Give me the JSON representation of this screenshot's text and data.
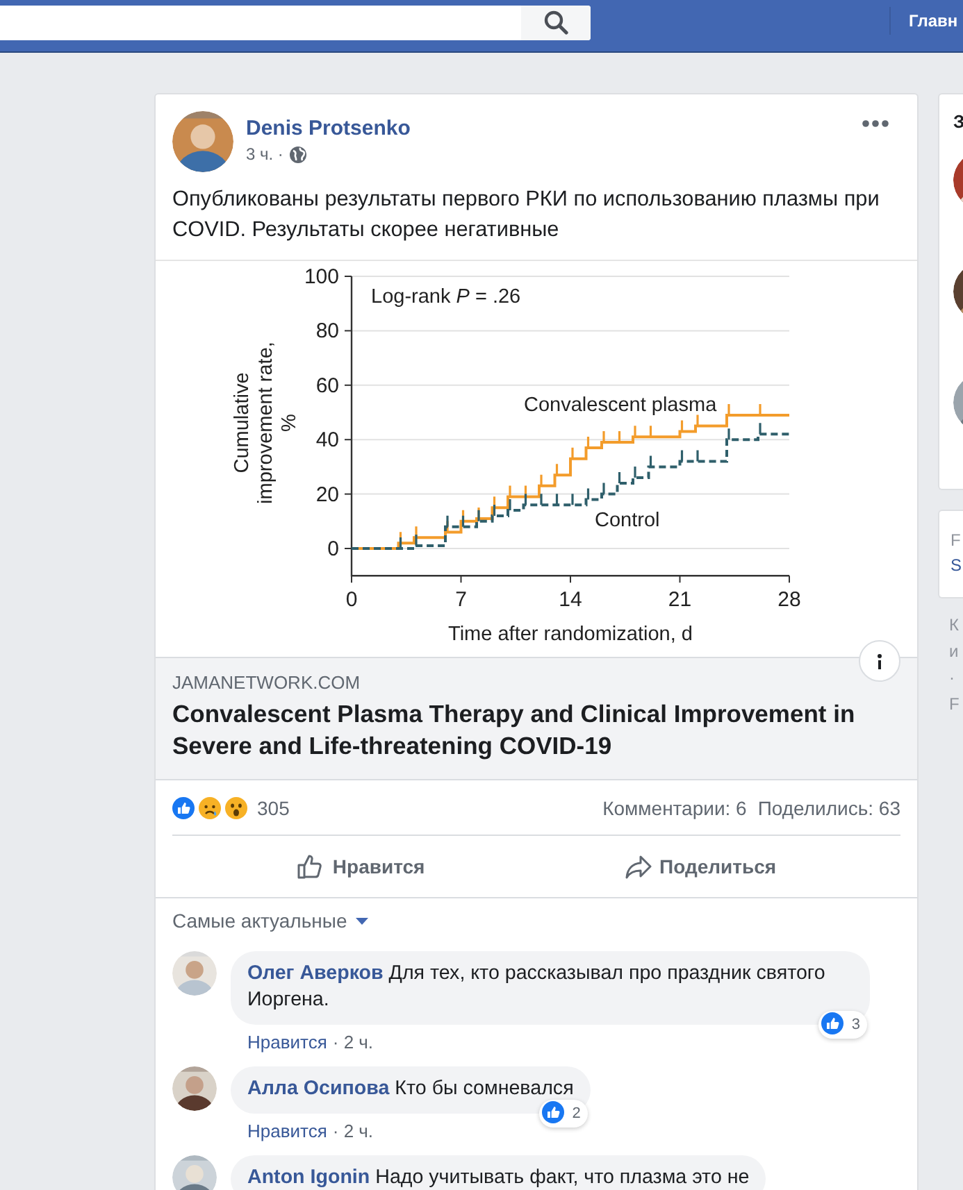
{
  "top_bar": {
    "nav_link": "Главн"
  },
  "post": {
    "author": "Denis Protsenko",
    "time": "3 ч. ·",
    "text": "Опубликованы результаты первого РКИ по использованию плазмы при COVID. Результаты скорее негативные",
    "chart_data": {
      "type": "line",
      "xlabel": "Time after randomization, d",
      "ylabel": "Cumulative improvement rate, %",
      "x": [
        0,
        3,
        3,
        4,
        4,
        6,
        6,
        7,
        7,
        8,
        8,
        9,
        9,
        10,
        10,
        11,
        11,
        12,
        12,
        13,
        13,
        14,
        14,
        15,
        15,
        16,
        16,
        17,
        17,
        18,
        18,
        19,
        19,
        21,
        21,
        22,
        22,
        24,
        24,
        26,
        26,
        28
      ],
      "series": [
        {
          "name": "Convalescent plasma",
          "color": "#f39c2b",
          "line_style": "solid",
          "values": [
            0,
            0,
            2,
            2,
            4,
            4,
            6,
            6,
            10,
            10,
            11,
            11,
            15,
            15,
            19,
            19,
            19,
            19,
            23,
            23,
            27,
            27,
            33,
            33,
            37,
            37,
            39,
            39,
            39,
            39,
            41,
            41,
            41,
            41,
            43,
            43,
            45,
            45,
            49,
            49,
            49,
            49
          ]
        },
        {
          "name": "Control",
          "color": "#2f5f6b",
          "line_style": "dashed",
          "values": [
            0,
            0,
            0,
            0,
            1,
            1,
            8,
            8,
            8,
            8,
            10,
            10,
            12,
            12,
            14,
            14,
            16,
            16,
            16,
            16,
            16,
            16,
            16,
            16,
            18,
            18,
            20,
            20,
            24,
            24,
            26,
            26,
            30,
            30,
            32,
            32,
            32,
            32,
            40,
            40,
            42,
            42
          ]
        }
      ],
      "xlim": [
        0,
        28
      ],
      "ylim": [
        -10,
        100
      ],
      "xticks": [
        0,
        7,
        14,
        21,
        28
      ],
      "yticks": [
        0,
        20,
        40,
        60,
        80,
        100
      ],
      "grid": true,
      "annotations": [
        "Log-rank *P* = .26"
      ]
    },
    "link": {
      "domain": "JAMANETWORK.COM",
      "title": "Convalescent Plasma Therapy and Clinical Improvement in Severe and Life-threatening COVID-19"
    },
    "reaction_count": "305",
    "comments_count": "Комментарии: 6",
    "shares_count": "Поделились: 63",
    "actions": [
      "Нравится",
      "Поделиться"
    ],
    "sort_label": "Самые актуальные",
    "comments": [
      {
        "author": "Олег Аверков",
        "text": "Для тех, кто рассказывал про праздник святого Иоргена.",
        "like": "Нравится",
        "time": "· 2 ч.",
        "reactions": "3"
      },
      {
        "author": "Алла Осипова",
        "text": "Кто бы сомневался",
        "like": "Нравится",
        "time": "· 2 ч.",
        "reactions": "2"
      },
      {
        "author": "Anton Igonin",
        "text": "Надо учитывать факт, что плазма это не"
      }
    ]
  },
  "right_column": {
    "card_title": "З",
    "second_card": [
      "F",
      "S"
    ],
    "below": [
      "К",
      "и",
      "·",
      "F"
    ]
  }
}
